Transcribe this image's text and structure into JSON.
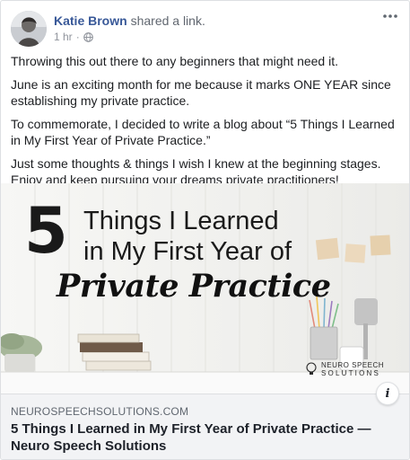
{
  "post": {
    "author": {
      "name": "Katie Brown",
      "action": "shared a link."
    },
    "timestamp": "1 hr",
    "audience_icon": "globe-icon",
    "more_icon": "ellipsis-icon",
    "paragraphs": [
      "Throwing this out there to any beginners that might need it.",
      "June is an exciting month for me because it marks ONE YEAR since establishing my private practice.",
      "To commemorate, I decided to write a blog about “5 Things I Learned in My First Year of Private Practice.”",
      "Just some thoughts & things I wish I knew at the beginning stages. Enjoy and keep pursuing your dreams private practitioners!"
    ]
  },
  "link_preview": {
    "image": {
      "number": "5",
      "line1": "Things I Learned",
      "line2": "in My First Year of",
      "script": "Private Practice",
      "brand_line1": "NEURO SPEECH",
      "brand_line2": "SOLUTIONS"
    },
    "domain": "NEUROSPEECHSOLUTIONS.COM",
    "title": "5 Things I Learned in My First Year of Private Practice — Neuro Speech Solutions",
    "info_label": "i"
  },
  "colors": {
    "author_link": "#385898",
    "meta_text": "#90949c",
    "caption_bg": "#f2f3f5",
    "border": "#dddfe2"
  }
}
